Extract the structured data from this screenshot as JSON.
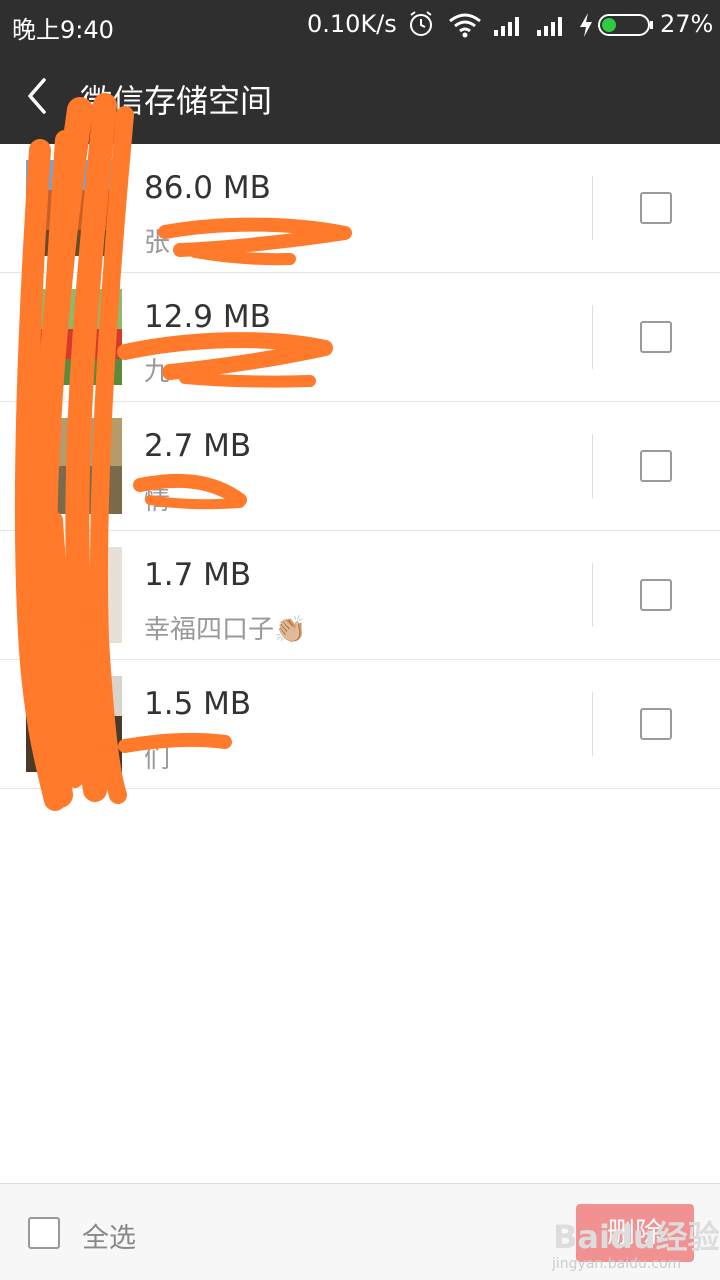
{
  "status_bar": {
    "time": "晚上9:40",
    "network_speed": "0.10K/s",
    "battery_percent": "27%",
    "battery_level": 0.27,
    "icons": [
      "alarm-icon",
      "wifi-icon",
      "signal-icon",
      "signal-icon",
      "charging-icon",
      "battery-icon"
    ]
  },
  "header": {
    "back_icon": "chevron-left-icon",
    "title": "微信存储空间"
  },
  "items": [
    {
      "size": "86.0 MB",
      "name": "张"
    },
    {
      "size": "12.9 MB",
      "name": "九"
    },
    {
      "size": "2.7 MB",
      "name": "情"
    },
    {
      "size": "1.7 MB",
      "name": "幸福四口子👏🏼"
    },
    {
      "size": "1.5 MB",
      "name": "们"
    }
  ],
  "footer": {
    "select_all": "全选",
    "delete_label": "删除"
  },
  "watermark": {
    "text": "Baidu经验",
    "sub": "jingyan.baidu.com"
  },
  "colors": {
    "topbar_bg": "#2f2f2f",
    "scribble": "#ff7a2a",
    "battery_green": "#2ecc40"
  }
}
